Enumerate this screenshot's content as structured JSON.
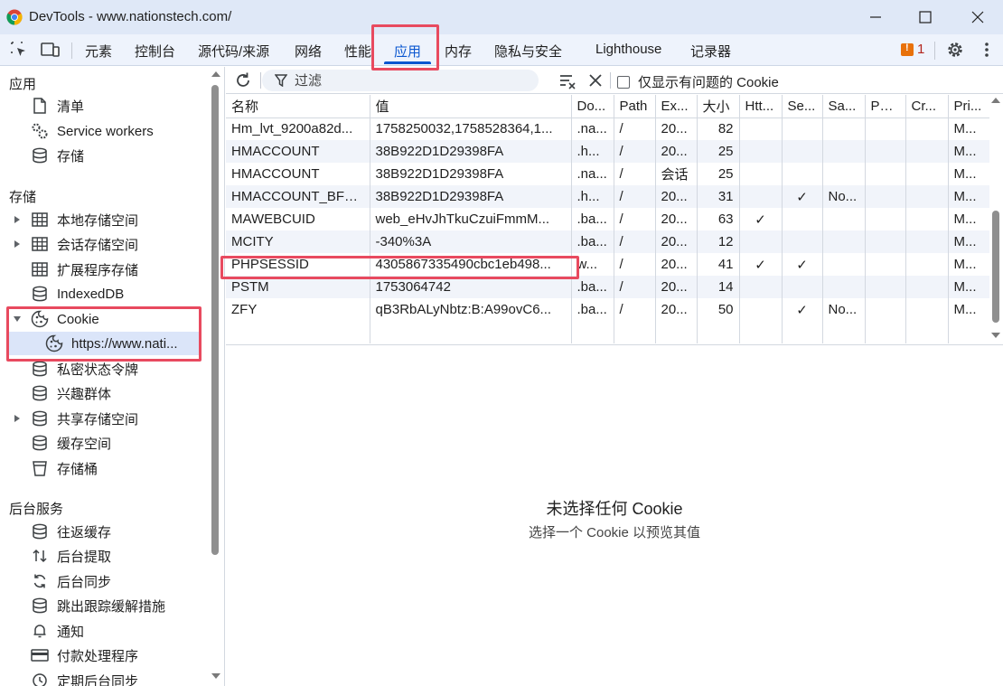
{
  "window": {
    "title": "DevTools - www.nationstech.com/",
    "minimize_icon": "minimize-icon",
    "maximize_icon": "maximize-icon",
    "close_icon": "close-icon"
  },
  "tabs": {
    "items": [
      "元素",
      "控制台",
      "源代码/来源",
      "网络",
      "性能",
      "应用",
      "内存",
      "隐私与安全",
      "Lighthouse",
      "记录器"
    ],
    "active": "应用",
    "issues_count": "1"
  },
  "sidebar": {
    "section_app": "应用",
    "app_items": [
      "清单",
      "Service workers",
      "存储"
    ],
    "section_storage": "存储",
    "storage_items": [
      "本地存储空间",
      "会话存储空间",
      "扩展程序存储",
      "IndexedDB",
      "Cookie",
      "https://www.nati...",
      "私密状态令牌",
      "兴趣群体",
      "共享存储空间",
      "缓存空间",
      "存储桶"
    ],
    "section_bg": "后台服务",
    "bg_items": [
      "往返缓存",
      "后台提取",
      "后台同步",
      "跳出跟踪缓解措施",
      "通知",
      "付款处理程序",
      "定期后台同步"
    ]
  },
  "toolbar": {
    "filter_placeholder": "过滤",
    "only_issues_label": "仅显示有问题的 Cookie"
  },
  "table": {
    "headers": [
      "名称",
      "值",
      "Do...",
      "Path",
      "Ex...",
      "大小",
      "Htt...",
      "Se...",
      "Sa...",
      "Par...",
      "Cr...",
      "Pri..."
    ],
    "rows": [
      [
        "Hm_lvt_9200a82d...",
        "1758250032,1758528364,1...",
        ".na...",
        "/",
        "20...",
        "82",
        "",
        "",
        "",
        "",
        "",
        "M..."
      ],
      [
        "HMACCOUNT",
        "38B922D1D29398FA",
        ".h...",
        "/",
        "20...",
        "25",
        "",
        "",
        "",
        "",
        "",
        "M..."
      ],
      [
        "HMACCOUNT",
        "38B922D1D29398FA",
        ".na...",
        "/",
        "会话",
        "25",
        "",
        "",
        "",
        "",
        "",
        "M..."
      ],
      [
        "HMACCOUNT_BFE...",
        "38B922D1D29398FA",
        ".h...",
        "/",
        "20...",
        "31",
        "",
        "✓",
        "No...",
        "",
        "",
        "M..."
      ],
      [
        "MAWEBCUID",
        "web_eHvJhTkuCzuiFmmM...",
        ".ba...",
        "/",
        "20...",
        "63",
        "✓",
        "",
        "",
        "",
        "",
        "M..."
      ],
      [
        "MCITY",
        "-340%3A",
        ".ba...",
        "/",
        "20...",
        "12",
        "",
        "",
        "",
        "",
        "",
        "M..."
      ],
      [
        "PHPSESSID",
        "4305867335490cbc1eb498...",
        "w...",
        "/",
        "20...",
        "41",
        "✓",
        "✓",
        "",
        "",
        "",
        "M..."
      ],
      [
        "PSTM",
        "1753064742",
        ".ba...",
        "/",
        "20...",
        "14",
        "",
        "",
        "",
        "",
        "",
        "M..."
      ],
      [
        "ZFY",
        "qB3RbALyNbtz:B:A99ovC6...",
        ".ba...",
        "/",
        "20...",
        "50",
        "",
        "✓",
        "No...",
        "",
        "",
        "M..."
      ]
    ]
  },
  "preview": {
    "title": "未选择任何 Cookie",
    "subtitle": "选择一个 Cookie 以预览其值"
  },
  "colors": {
    "accent": "#0b57d0",
    "annotation_red": "#e84a5f",
    "titlebar_bg": "#dfe8f7"
  }
}
